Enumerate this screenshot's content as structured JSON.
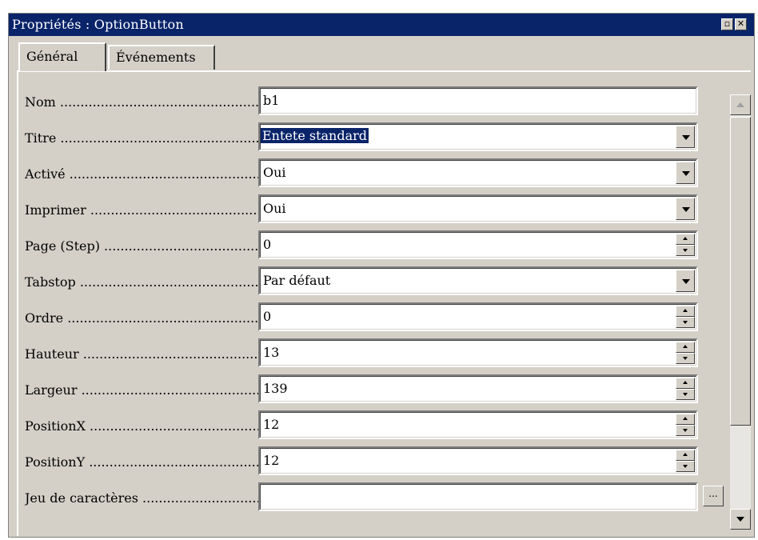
{
  "window": {
    "title": "Propriétés : OptionButton",
    "restore_glyph": "▫",
    "close_glyph": "✕"
  },
  "tabs": [
    {
      "label": "Général",
      "active": true
    },
    {
      "label": "Événements",
      "active": false
    }
  ],
  "properties": [
    {
      "label": "Nom",
      "value": "b1",
      "control": "text"
    },
    {
      "label": "Titre",
      "value": "Entete standard",
      "control": "dropdown",
      "selected": true
    },
    {
      "label": "Activé",
      "value": "Oui",
      "control": "dropdown"
    },
    {
      "label": "Imprimer",
      "value": "Oui",
      "control": "dropdown"
    },
    {
      "label": "Page (Step)",
      "value": "0",
      "control": "spinner"
    },
    {
      "label": "Tabstop",
      "value": "Par défaut",
      "control": "dropdown"
    },
    {
      "label": "Ordre",
      "value": "0",
      "control": "spinner"
    },
    {
      "label": "Hauteur",
      "value": "13",
      "control": "spinner"
    },
    {
      "label": "Largeur",
      "value": "139",
      "control": "spinner"
    },
    {
      "label": "PositionX",
      "value": "12",
      "control": "spinner"
    },
    {
      "label": "PositionY",
      "value": "12",
      "control": "spinner"
    },
    {
      "label": "Jeu de caractères",
      "value": "",
      "control": "ellipsis",
      "button_label": "..."
    }
  ],
  "colors": {
    "titlebar": "#0a246a",
    "face": "#d4d0c8",
    "selection": "#0a246a"
  },
  "icons": {
    "dropdown": "chevron-down-icon",
    "spin": "spin-arrows-icon",
    "scroll_up": "arrow-up-icon",
    "scroll_down": "arrow-down-icon"
  }
}
